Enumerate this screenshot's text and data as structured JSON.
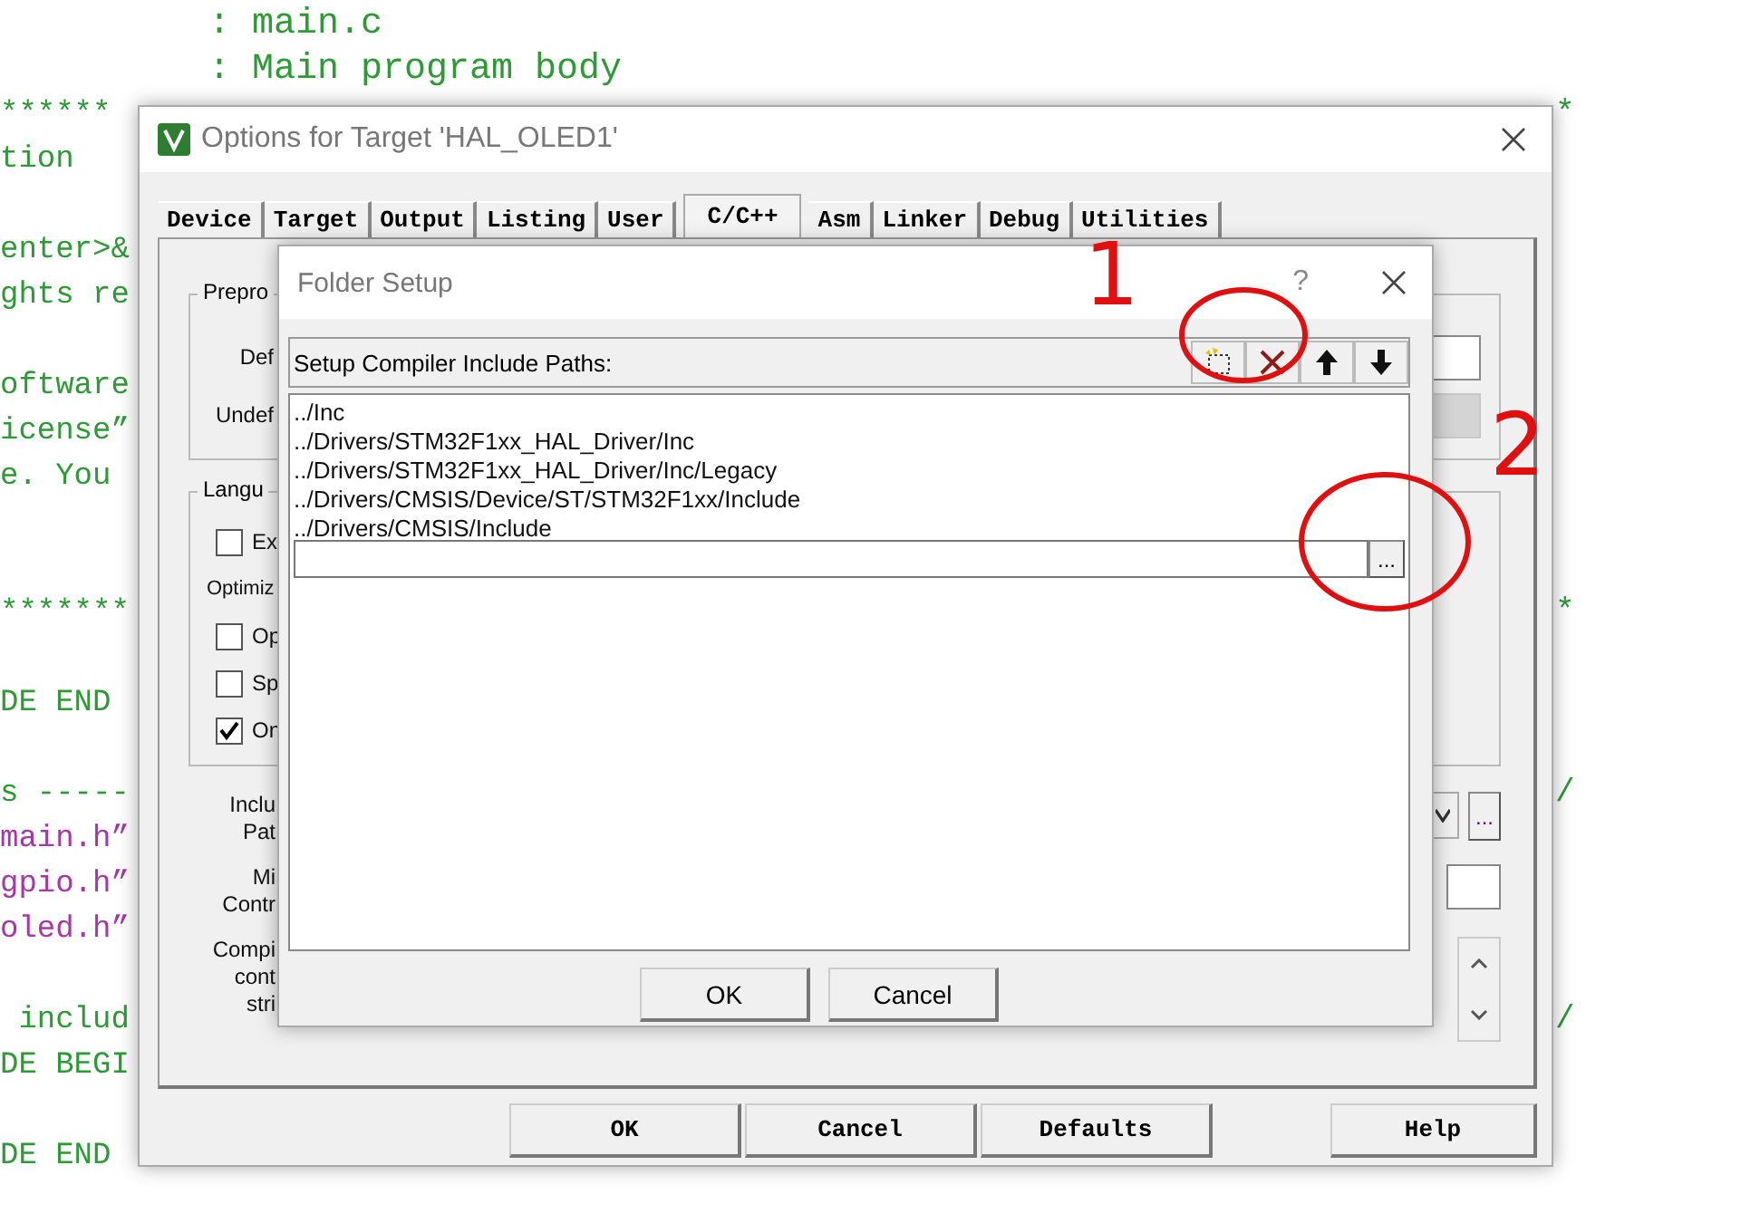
{
  "editor": {
    "lines": [
      {
        "text": ": main.c",
        "kind": "header"
      },
      {
        "text": ": Main program body",
        "kind": "header"
      },
      {
        "text": "******",
        "kind": "comment",
        "right": "*"
      },
      {
        "text": "tion",
        "kind": "comment"
      },
      {
        "kind": "blank"
      },
      {
        "text": "enter>&",
        "kind": "comment"
      },
      {
        "text": "ghts re",
        "kind": "comment"
      },
      {
        "kind": "blank"
      },
      {
        "text": "oftware",
        "kind": "comment"
      },
      {
        "text": "icense”",
        "kind": "comment"
      },
      {
        "text": "e. You",
        "kind": "comment"
      },
      {
        "kind": "blank"
      },
      {
        "kind": "blank"
      },
      {
        "text": "*******",
        "kind": "comment",
        "right": "*"
      },
      {
        "kind": "blank"
      },
      {
        "text": "DE END",
        "kind": "comment"
      },
      {
        "kind": "blank"
      },
      {
        "text": "s -----",
        "kind": "comment",
        "right": "/"
      },
      {
        "text": "main.h”",
        "kind": "string"
      },
      {
        "text": "gpio.h”",
        "kind": "string"
      },
      {
        "text": "oled.h”",
        "kind": "string"
      },
      {
        "kind": "blank"
      },
      {
        "text": " includ",
        "kind": "comment",
        "right": "/"
      },
      {
        "text": "DE BEGI",
        "kind": "comment"
      },
      {
        "kind": "blank"
      },
      {
        "text": "DE END",
        "kind": "comment"
      }
    ]
  },
  "options_dialog": {
    "title": "Options for Target 'HAL_OLED1'",
    "tabs": [
      {
        "label": "Device",
        "selected": false
      },
      {
        "label": "Target",
        "selected": false
      },
      {
        "label": "Output",
        "selected": false
      },
      {
        "label": "Listing",
        "selected": false
      },
      {
        "label": "User",
        "selected": false
      },
      {
        "label": "C/C++",
        "selected": true
      },
      {
        "label": "Asm",
        "selected": false
      },
      {
        "label": "Linker",
        "selected": false
      },
      {
        "label": "Debug",
        "selected": false
      },
      {
        "label": "Utilities",
        "selected": false
      }
    ],
    "preprocessor_group": {
      "title": "Prepro",
      "rows": [
        {
          "label": "Def",
          "disabled": false
        },
        {
          "label": "Undef",
          "disabled": true
        }
      ]
    },
    "language_group": {
      "title": "Langu",
      "items": [
        {
          "kind": "checkbox",
          "label": "Ex",
          "checked": false
        },
        {
          "kind": "label",
          "label": "Optimiz"
        },
        {
          "kind": "checkbox",
          "label": "Op",
          "checked": false
        },
        {
          "kind": "checkbox",
          "label": "Sp",
          "checked": false
        },
        {
          "kind": "checkbox",
          "label": "On",
          "checked": true
        }
      ]
    },
    "include_label": [
      "Inclu",
      "Pat"
    ],
    "browse_button": "...",
    "misc_label": [
      "Mi",
      "Contr"
    ],
    "control_label": [
      "Compi",
      "cont",
      "stri"
    ],
    "buttons": [
      "OK",
      "Cancel",
      "Defaults",
      "Help"
    ]
  },
  "folder_dialog": {
    "title": "Folder Setup",
    "help": "?",
    "header": "Setup Compiler Include Paths:",
    "paths": [
      "../Inc",
      "../Drivers/STM32F1xx_HAL_Driver/Inc",
      "../Drivers/STM32F1xx_HAL_Driver/Inc/Legacy",
      "../Drivers/CMSIS/Device/ST/STM32F1xx/Include",
      "../Drivers/CMSIS/Include"
    ],
    "browse_button": "...",
    "buttons": [
      "OK",
      "Cancel"
    ]
  },
  "annotations": [
    {
      "kind": "number",
      "text": "1"
    },
    {
      "kind": "circle"
    },
    {
      "kind": "circle"
    },
    {
      "kind": "number",
      "text": "2"
    }
  ]
}
